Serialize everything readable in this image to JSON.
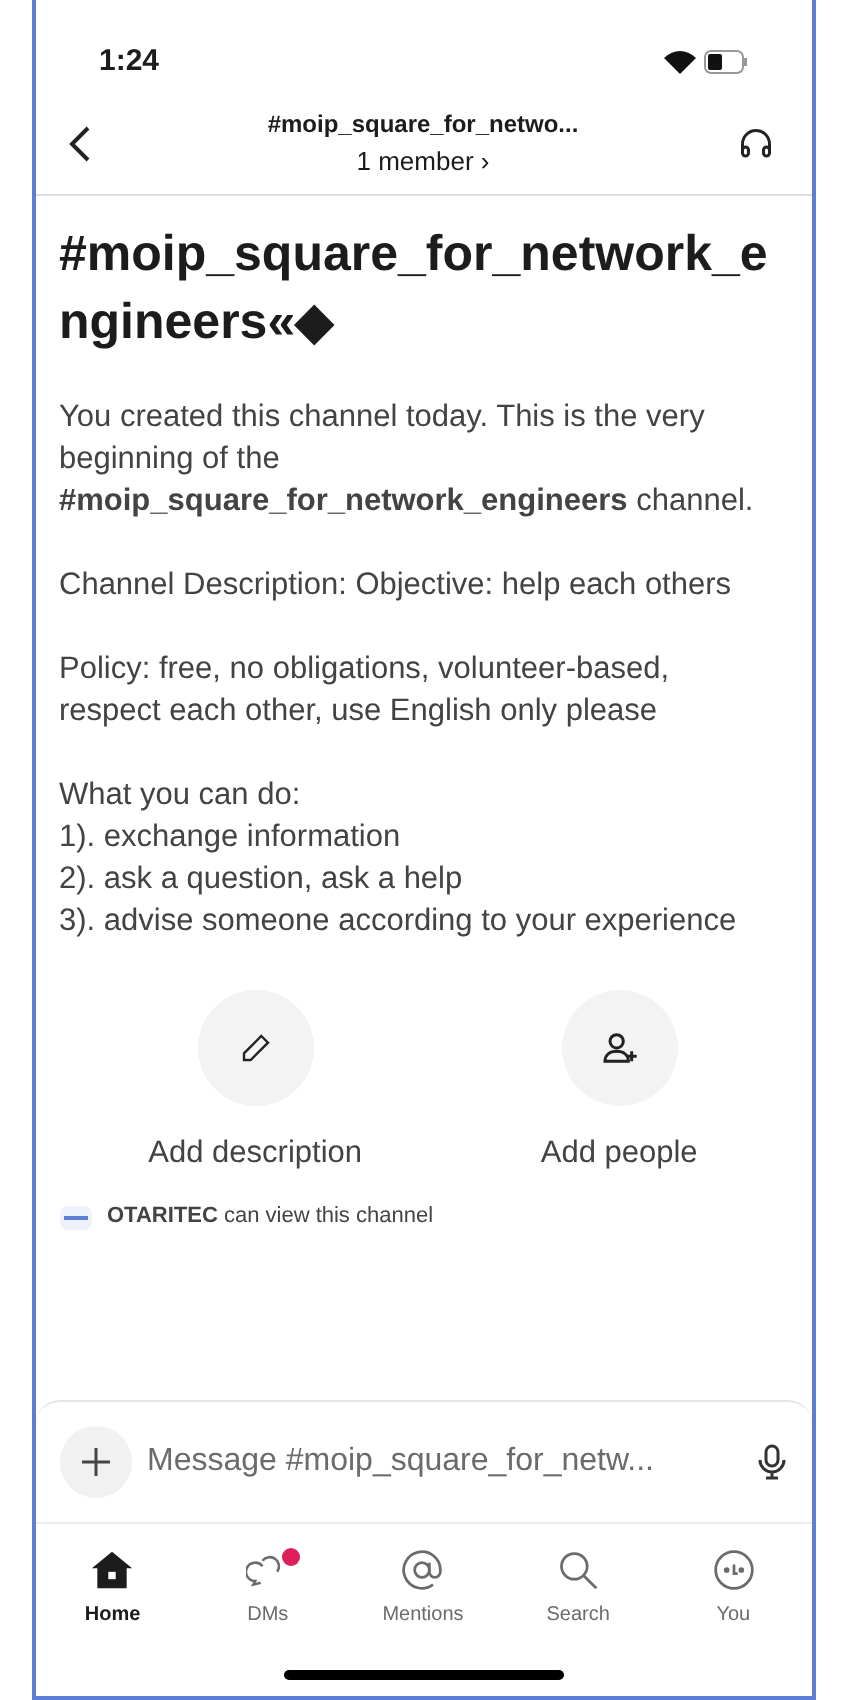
{
  "status_bar": {
    "time": "1:24"
  },
  "header": {
    "title": "#moip_square_for_netwo...",
    "subtitle": "1 member ›"
  },
  "channel": {
    "title": "#moip_square_for_network_engineers«◆",
    "paragraphs": [
      "You created this channel today. This is the very beginning of the **#moip_square_for_network_engineers** channel.",
      "Channel Description: Objective: help each others",
      "Policy: free, no obligations, volunteer-based, respect each other, use English only please"
    ],
    "can_do": {
      "heading": "What you can do:",
      "items": [
        "1). exchange information",
        "2). ask a question, ask a help",
        "3). advise someone according to your experience"
      ]
    }
  },
  "actions": [
    {
      "kind": "pencil",
      "label": "Add description"
    },
    {
      "kind": "person-add",
      "label": "Add people"
    }
  ],
  "visibility": "**OTARITEC** can view this channel",
  "composer": {
    "placeholder": "Message #moip_square_for_netw..."
  },
  "tabs": [
    {
      "kind": "home",
      "label": "Home",
      "selected": true,
      "badge": false
    },
    {
      "kind": "dms",
      "label": "DMs",
      "selected": false,
      "badge": true
    },
    {
      "kind": "mentions",
      "label": "Mentions",
      "selected": false,
      "badge": false
    },
    {
      "kind": "search",
      "label": "Search",
      "selected": false,
      "badge": false
    },
    {
      "kind": "you",
      "label": "You",
      "selected": false,
      "badge": false
    }
  ]
}
